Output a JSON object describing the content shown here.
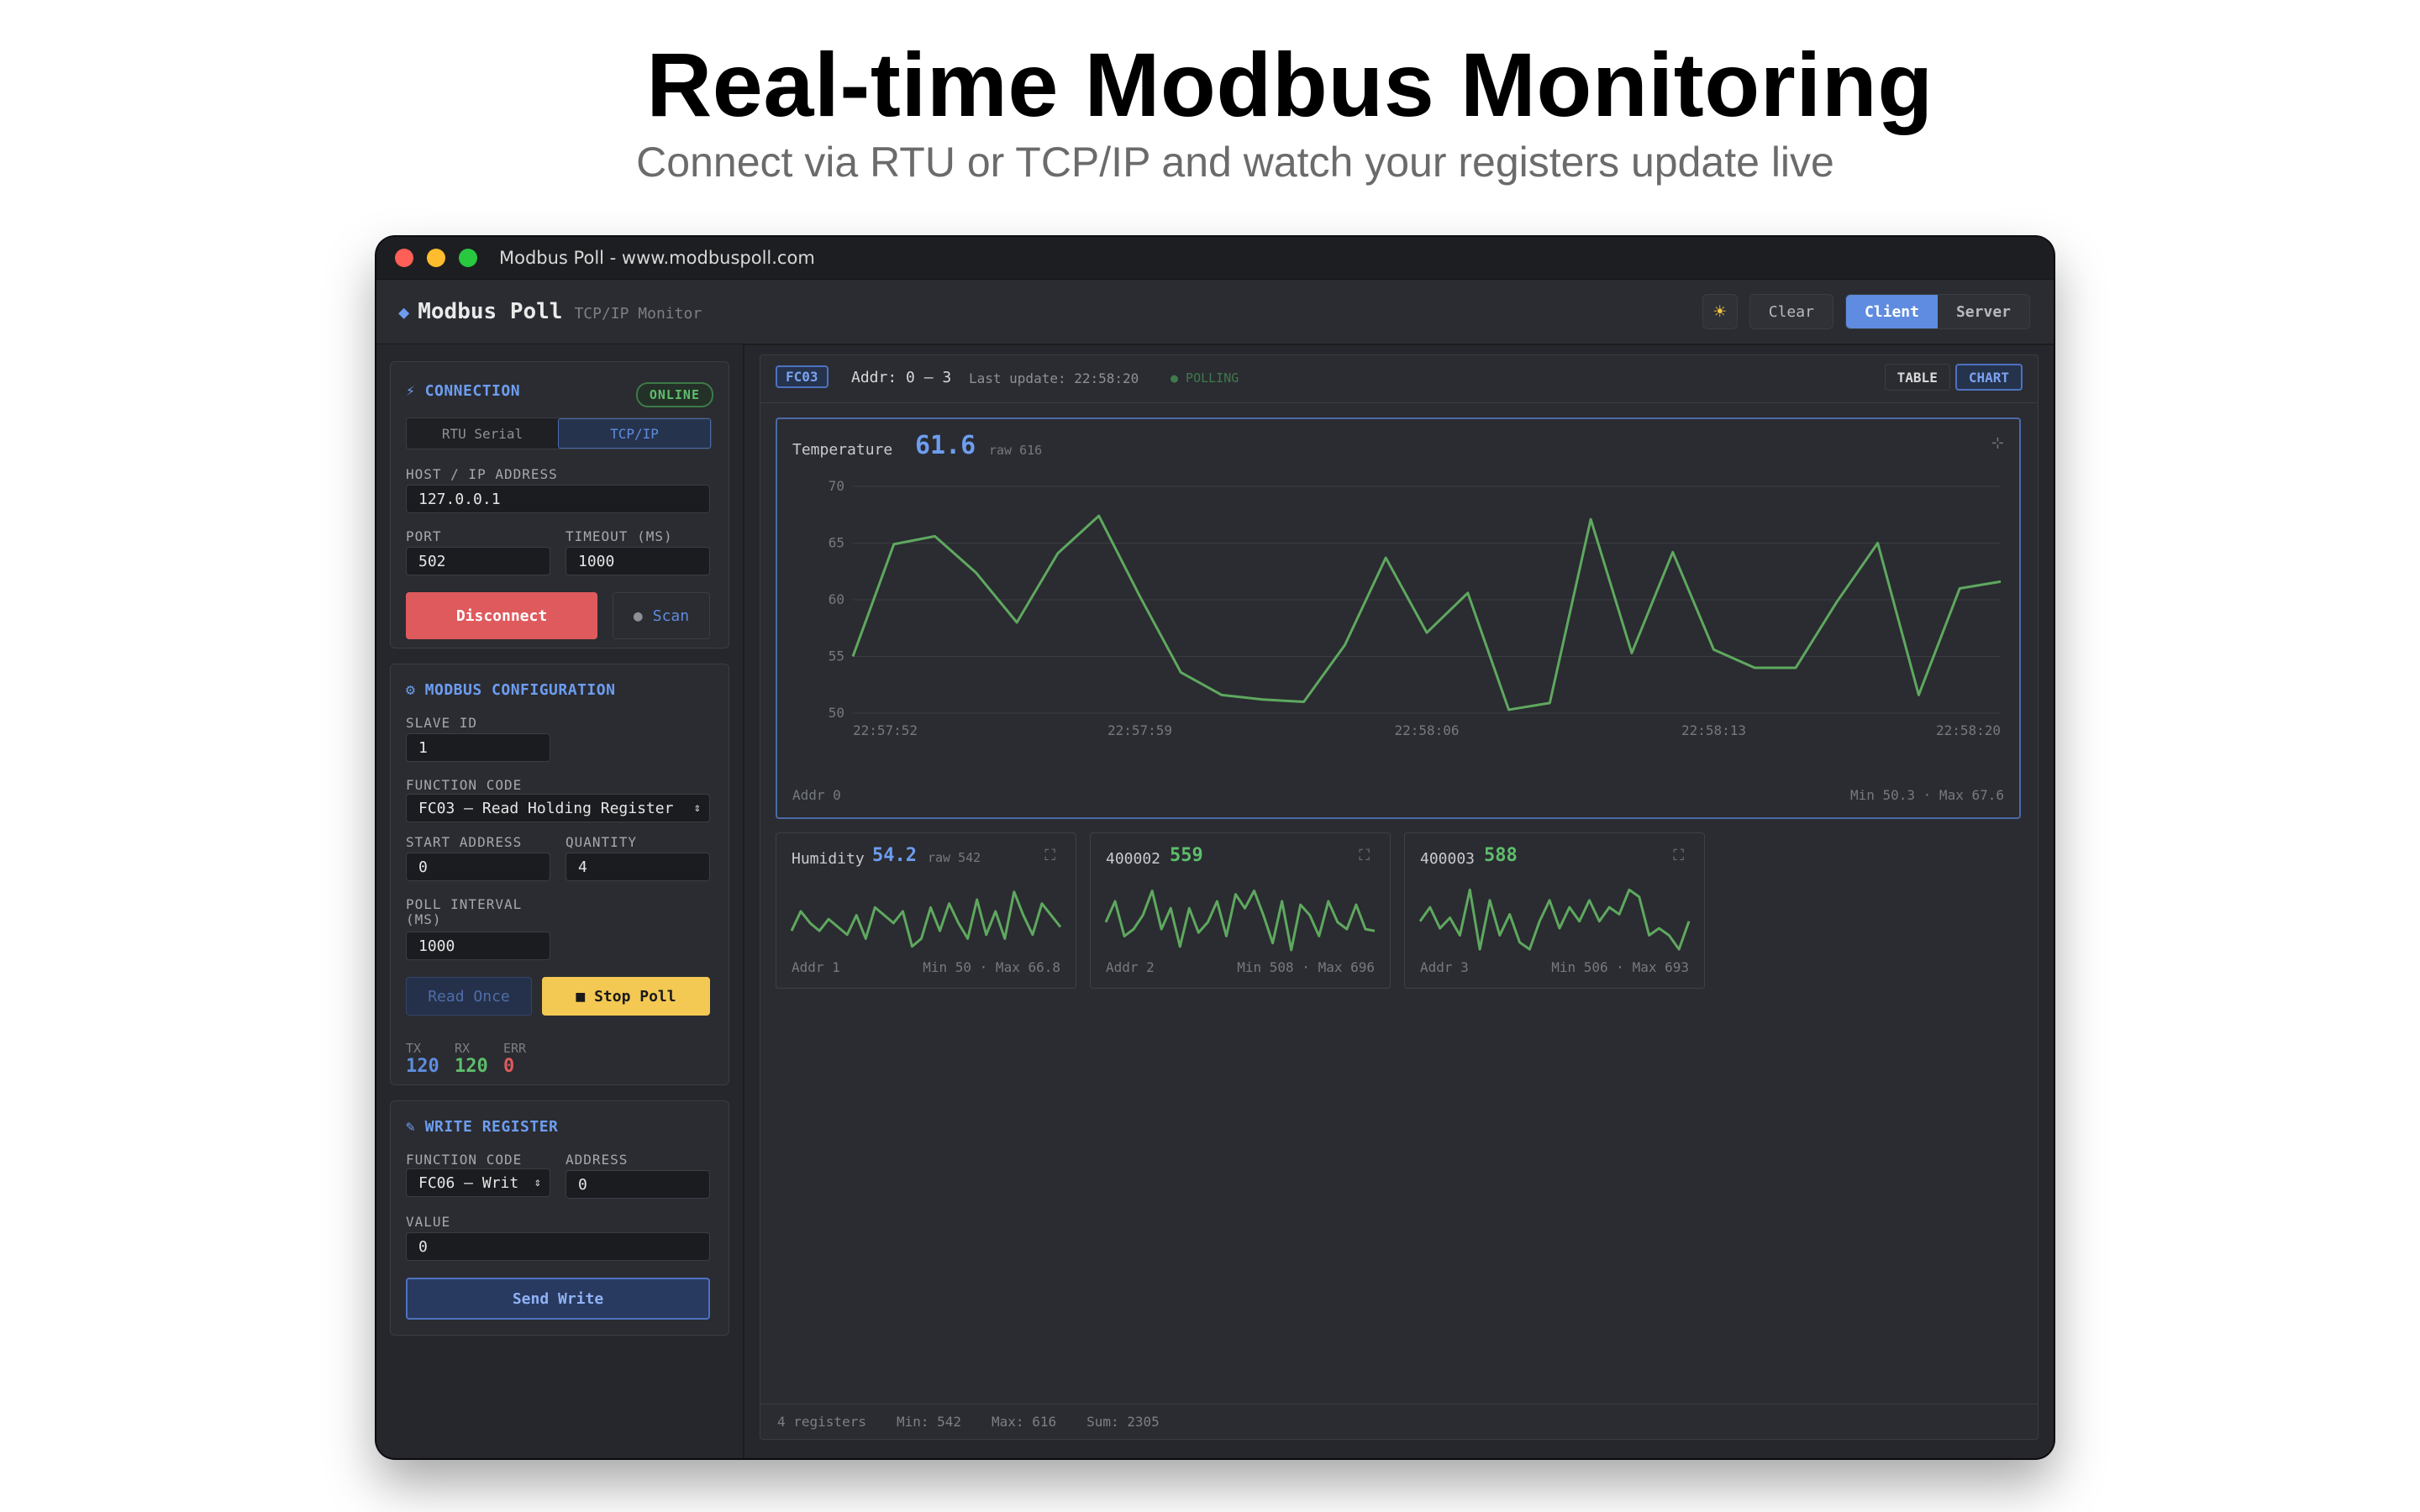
{
  "hero": {
    "title": "Real-time Modbus Monitoring",
    "subtitle": "Connect via RTU or TCP/IP and watch your registers update live"
  },
  "window": {
    "title": "Modbus Poll - www.modbuspoll.com"
  },
  "appbar": {
    "brand_icon": "diamond-icon",
    "brand_name": "Modbus Poll",
    "brand_sub": "TCP/IP Monitor",
    "theme_icon": "sun-icon",
    "clear_label": "Clear",
    "modes": [
      "Client",
      "Server"
    ],
    "active_mode": "Client"
  },
  "connection": {
    "title": "⚡ CONNECTION",
    "status": "ONLINE",
    "tabs": [
      "RTU Serial",
      "TCP/IP"
    ],
    "active_tab": "TCP/IP",
    "host_label": "HOST / IP ADDRESS",
    "host_value": "127.0.0.1",
    "port_label": "PORT",
    "port_value": "502",
    "timeout_label": "TIMEOUT (MS)",
    "timeout_value": "1000",
    "disconnect_label": "Disconnect",
    "scan_label": "Scan",
    "scan_icon": "magnifier-icon"
  },
  "config": {
    "title": "⚙ MODBUS CONFIGURATION",
    "slave_label": "SLAVE ID",
    "slave_value": "1",
    "fc_label": "FUNCTION CODE",
    "fc_value": "FC03 — Read Holding Register",
    "start_label": "START ADDRESS",
    "start_value": "0",
    "qty_label": "QUANTITY",
    "qty_value": "4",
    "poll_label_1": "POLL INTERVAL",
    "poll_label_2": "(MS)",
    "poll_value": "1000",
    "read_once_label": "Read Once",
    "stop_poll_label": "■ Stop Poll",
    "tx_label": "TX",
    "tx_value": "120",
    "rx_label": "RX",
    "rx_value": "120",
    "err_label": "ERR",
    "err_value": "0"
  },
  "write": {
    "title": "✎ WRITE REGISTER",
    "fc_label": "FUNCTION CODE",
    "fc_value": "FC06 — Writ",
    "addr_label": "ADDRESS",
    "addr_value": "0",
    "value_label": "VALUE",
    "value_value": "0",
    "send_label": "Send Write"
  },
  "mainbar": {
    "fc_badge": "FC03",
    "addr": "Addr: 0 – 3",
    "last_update": "Last update: 22:58:20",
    "polling": "● POLLING",
    "views": [
      "TABLE",
      "CHART"
    ],
    "active_view": "CHART"
  },
  "colors": {
    "accent": "#5f8ce0",
    "series": "#5fa85f",
    "danger": "#df5a5d",
    "warn": "#f3c853"
  },
  "main_card": {
    "name": "Temperature",
    "value": "61.6",
    "raw": "raw 616",
    "addr": "Addr 0",
    "minmax": "Min 50.3 · Max 67.6",
    "expand_icon": "move-icon"
  },
  "small_cards": [
    {
      "name": "Humidity",
      "value": "54.2",
      "raw": "raw 542",
      "addr": "Addr 1",
      "minmax": "Min 50 · Max 66.8"
    },
    {
      "name": "400002",
      "value": "559",
      "raw": "",
      "addr": "Addr 2",
      "minmax": "Min 508 · Max 696"
    },
    {
      "name": "400003",
      "value": "588",
      "raw": "",
      "addr": "Addr 3",
      "minmax": "Min 506 · Max 693"
    }
  ],
  "footer": {
    "registers": "4 registers",
    "min": "Min: 542",
    "max": "Max: 616",
    "sum": "Sum: 2305"
  },
  "chart_data": [
    {
      "type": "line",
      "title": "Temperature",
      "ylim": [
        50,
        70
      ],
      "yticks": [
        50,
        55,
        60,
        65,
        70
      ],
      "xticks": [
        "22:57:52",
        "22:57:59",
        "22:58:06",
        "22:58:13",
        "22:58:20"
      ],
      "series": [
        {
          "name": "Temperature",
          "values": [
            55,
            64.9,
            65.6,
            62.4,
            58,
            64.1,
            67.4,
            60.3,
            53.6,
            51.6,
            51.2,
            51,
            56,
            63.7,
            57.1,
            60.6,
            50.3,
            50.9,
            67.1,
            55.3,
            64.2,
            55.6,
            54,
            54,
            59.8,
            65,
            51.6,
            61,
            61.6
          ]
        }
      ]
    },
    {
      "type": "line",
      "title": "Humidity",
      "ylim": [
        50,
        66.8
      ],
      "series": [
        {
          "values": [
            56,
            61,
            58,
            56,
            59,
            57,
            55,
            60,
            54,
            62,
            60,
            58,
            61,
            52,
            54,
            62,
            56,
            63,
            58,
            54,
            64,
            55,
            61,
            54,
            66,
            60,
            55,
            63,
            60,
            57
          ]
        }
      ]
    },
    {
      "type": "line",
      "title": "400002",
      "ylim": [
        508,
        696
      ],
      "series": [
        {
          "values": [
            600,
            660,
            560,
            580,
            620,
            690,
            580,
            640,
            530,
            640,
            570,
            600,
            660,
            560,
            680,
            640,
            690,
            620,
            540,
            660,
            520,
            650,
            620,
            560,
            660,
            600,
            580,
            650,
            580,
            575
          ]
        }
      ]
    },
    {
      "type": "line",
      "title": "400003",
      "ylim": [
        506,
        693
      ],
      "series": [
        {
          "values": [
            600,
            640,
            580,
            610,
            560,
            690,
            520,
            660,
            560,
            620,
            540,
            520,
            600,
            660,
            580,
            640,
            600,
            660,
            600,
            640,
            620,
            690,
            670,
            560,
            580,
            560,
            520,
            600
          ]
        }
      ]
    }
  ]
}
